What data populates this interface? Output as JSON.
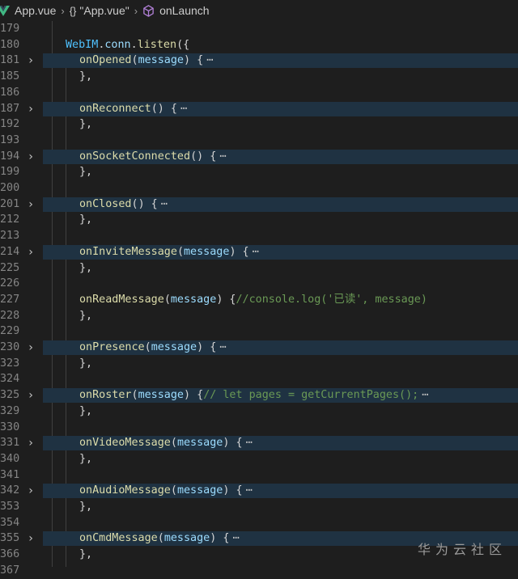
{
  "breadcrumb": {
    "file": "App.vue",
    "symbol_braces": "{}",
    "object": "\"App.vue\"",
    "method": "onLaunch"
  },
  "lines": [
    {
      "n": "179",
      "text": "",
      "fold": false,
      "hl": false
    },
    {
      "n": "180",
      "text": "WebIM.conn.listen({",
      "fold": false,
      "hl": false,
      "kind": "head"
    },
    {
      "n": "181",
      "fn": "onOpened",
      "params": "message",
      "tail": " {",
      "ell": "⋯",
      "fold": true,
      "hl": true
    },
    {
      "n": "185",
      "text": "},",
      "fold": false,
      "hl": false
    },
    {
      "n": "186",
      "text": "",
      "fold": false,
      "hl": false
    },
    {
      "n": "187",
      "fn": "onReconnect",
      "params": "",
      "tail": " {",
      "ell": "⋯",
      "fold": true,
      "hl": true
    },
    {
      "n": "192",
      "text": "},",
      "fold": false,
      "hl": false
    },
    {
      "n": "193",
      "text": "",
      "fold": false,
      "hl": false
    },
    {
      "n": "194",
      "fn": "onSocketConnected",
      "params": "",
      "tail": " {",
      "ell": "⋯",
      "fold": true,
      "hl": true
    },
    {
      "n": "199",
      "text": "},",
      "fold": false,
      "hl": false
    },
    {
      "n": "200",
      "text": "",
      "fold": false,
      "hl": false
    },
    {
      "n": "201",
      "fn": "onClosed",
      "params": "",
      "tail": " {",
      "ell": "⋯",
      "fold": true,
      "hl": true
    },
    {
      "n": "212",
      "text": "},",
      "fold": false,
      "hl": false
    },
    {
      "n": "213",
      "text": "",
      "fold": false,
      "hl": false
    },
    {
      "n": "214",
      "fn": "onInviteMessage",
      "params": "message",
      "tail": " {",
      "ell": "⋯",
      "fold": true,
      "hl": true
    },
    {
      "n": "225",
      "text": "},",
      "fold": false,
      "hl": false
    },
    {
      "n": "226",
      "text": "",
      "fold": false,
      "hl": false
    },
    {
      "n": "227",
      "fn": "onReadMessage",
      "params": "message",
      "tail": " {",
      "comment": "//console.log('已读', message)",
      "fold": false,
      "hl": false
    },
    {
      "n": "228",
      "text": "},",
      "fold": false,
      "hl": false
    },
    {
      "n": "229",
      "text": "",
      "fold": false,
      "hl": false
    },
    {
      "n": "230",
      "fn": "onPresence",
      "params": "message",
      "tail": " {",
      "ell": "⋯",
      "fold": true,
      "hl": true
    },
    {
      "n": "323",
      "text": "},",
      "fold": false,
      "hl": false
    },
    {
      "n": "324",
      "text": "",
      "fold": false,
      "hl": false
    },
    {
      "n": "325",
      "fn": "onRoster",
      "params": "message",
      "tail": " {",
      "comment": "// let pages = getCurrentPages();",
      "ell": "⋯",
      "fold": true,
      "hl": true
    },
    {
      "n": "329",
      "text": "},",
      "fold": false,
      "hl": false
    },
    {
      "n": "330",
      "text": "",
      "fold": false,
      "hl": false
    },
    {
      "n": "331",
      "fn": "onVideoMessage",
      "params": "message",
      "tail": " {",
      "ell": "⋯",
      "fold": true,
      "hl": true
    },
    {
      "n": "340",
      "text": "},",
      "fold": false,
      "hl": false
    },
    {
      "n": "341",
      "text": "",
      "fold": false,
      "hl": false
    },
    {
      "n": "342",
      "fn": "onAudioMessage",
      "params": "message",
      "tail": " {",
      "ell": "⋯",
      "fold": true,
      "hl": true
    },
    {
      "n": "353",
      "text": "},",
      "fold": false,
      "hl": false
    },
    {
      "n": "354",
      "text": "",
      "fold": false,
      "hl": false
    },
    {
      "n": "355",
      "fn": "onCmdMessage",
      "params": "message",
      "tail": " {",
      "ell": "⋯",
      "fold": true,
      "hl": true
    },
    {
      "n": "366",
      "text": "},",
      "fold": false,
      "hl": false
    },
    {
      "n": "367",
      "text": "",
      "fold": false,
      "hl": false
    }
  ],
  "watermark": "华为云社区",
  "colors": {
    "background": "#1e1e1e",
    "folded_highlight": "#1f3242",
    "function": "#dcdcaa",
    "parameter": "#9cdcfe",
    "comment": "#6a9955"
  }
}
